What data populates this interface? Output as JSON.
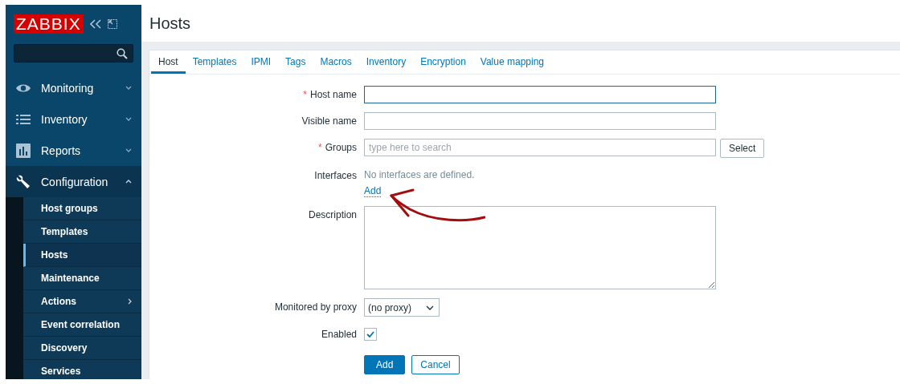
{
  "sidebar": {
    "logo": "ZABBIX",
    "menu": [
      {
        "label": "Monitoring",
        "expanded": false,
        "selected": false
      },
      {
        "label": "Inventory",
        "expanded": false,
        "selected": false
      },
      {
        "label": "Reports",
        "expanded": false,
        "selected": false
      },
      {
        "label": "Configuration",
        "expanded": true,
        "selected": true,
        "children": [
          {
            "label": "Host groups",
            "selected": false,
            "has_submenu": false
          },
          {
            "label": "Templates",
            "selected": false,
            "has_submenu": false
          },
          {
            "label": "Hosts",
            "selected": true,
            "has_submenu": false
          },
          {
            "label": "Maintenance",
            "selected": false,
            "has_submenu": false
          },
          {
            "label": "Actions",
            "selected": false,
            "has_submenu": true
          },
          {
            "label": "Event correlation",
            "selected": false,
            "has_submenu": false
          },
          {
            "label": "Discovery",
            "selected": false,
            "has_submenu": false
          },
          {
            "label": "Services",
            "selected": false,
            "has_submenu": false
          }
        ]
      }
    ]
  },
  "page": {
    "title": "Hosts"
  },
  "tabs": [
    {
      "label": "Host",
      "selected": true
    },
    {
      "label": "Templates",
      "selected": false
    },
    {
      "label": "IPMI",
      "selected": false
    },
    {
      "label": "Tags",
      "selected": false
    },
    {
      "label": "Macros",
      "selected": false
    },
    {
      "label": "Inventory",
      "selected": false
    },
    {
      "label": "Encryption",
      "selected": false
    },
    {
      "label": "Value mapping",
      "selected": false
    }
  ],
  "form": [
    {
      "kind": "text",
      "required_mark": "*",
      "label": "Host name",
      "focused": true
    },
    {
      "kind": "text",
      "label": "Visible name",
      "focused": false
    },
    {
      "kind": "multiselect",
      "required_mark": "*",
      "label": "Groups",
      "placeholder": "type here to search",
      "button": "Select"
    },
    {
      "kind": "interfaces",
      "label": "Interfaces",
      "note": "No interfaces are defined.",
      "link": "Add"
    },
    {
      "kind": "textarea",
      "label": "Description"
    },
    {
      "kind": "select",
      "label": "Monitored by proxy",
      "value": "(no proxy)"
    },
    {
      "kind": "checkbox",
      "label": "Enabled",
      "checked": true
    }
  ],
  "buttons": [
    {
      "label": "Add",
      "primary": true
    },
    {
      "label": "Cancel",
      "primary": false
    }
  ]
}
